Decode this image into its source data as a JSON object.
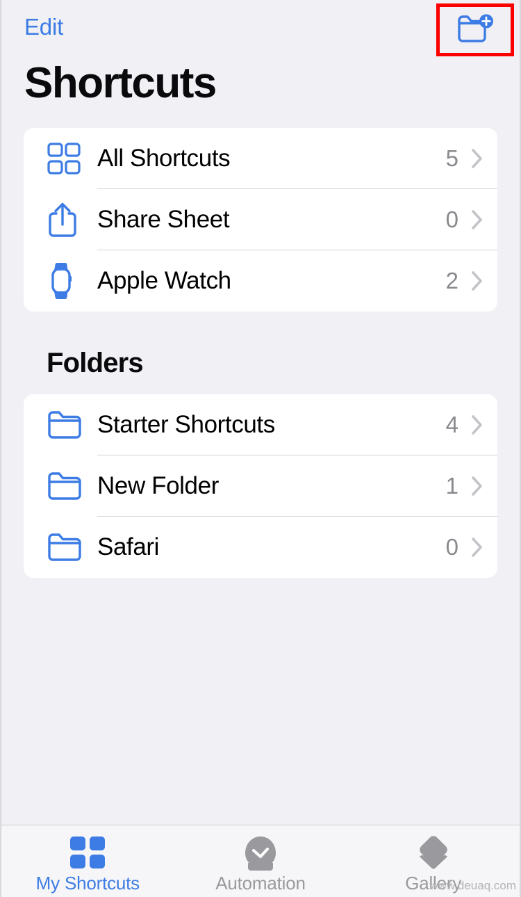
{
  "nav": {
    "edit_label": "Edit",
    "new_folder_icon": "folder-plus-icon",
    "highlight_color": "#fc0000"
  },
  "header": {
    "title": "Shortcuts"
  },
  "theme": {
    "background": "#f0f0f5",
    "card": "#ffffff",
    "accent": "#3d7ce4",
    "secondary_text": "#8a8a8e",
    "chevron": "#c4c4c8",
    "separator": "#d3d3d6"
  },
  "main": {
    "shortcuts_section": {
      "rows": [
        {
          "icon": "grid-icon",
          "label": "All Shortcuts",
          "count": "5",
          "chevron": "chevron-right-icon"
        },
        {
          "icon": "share-sheet-icon",
          "label": "Share Sheet",
          "count": "0",
          "chevron": "chevron-right-icon"
        },
        {
          "icon": "apple-watch-icon",
          "label": "Apple Watch",
          "count": "2",
          "chevron": "chevron-right-icon"
        }
      ]
    },
    "folders_section": {
      "heading": "Folders",
      "rows": [
        {
          "icon": "folder-icon",
          "label": "Starter Shortcuts",
          "count": "4",
          "chevron": "chevron-right-icon"
        },
        {
          "icon": "folder-icon",
          "label": "New Folder",
          "count": "1",
          "chevron": "chevron-right-icon"
        },
        {
          "icon": "folder-icon",
          "label": "Safari",
          "count": "0",
          "chevron": "chevron-right-icon"
        }
      ]
    }
  },
  "tabbar": {
    "tabs": [
      {
        "label": "My Shortcuts",
        "icon": "grid-filled-icon",
        "active": true
      },
      {
        "label": "Automation",
        "icon": "checkmark-circle-icon",
        "active": false
      },
      {
        "label": "Gallery",
        "icon": "stacked-diamonds-icon",
        "active": false
      }
    ]
  },
  "watermark": {
    "text": "www.deuaq.com"
  }
}
